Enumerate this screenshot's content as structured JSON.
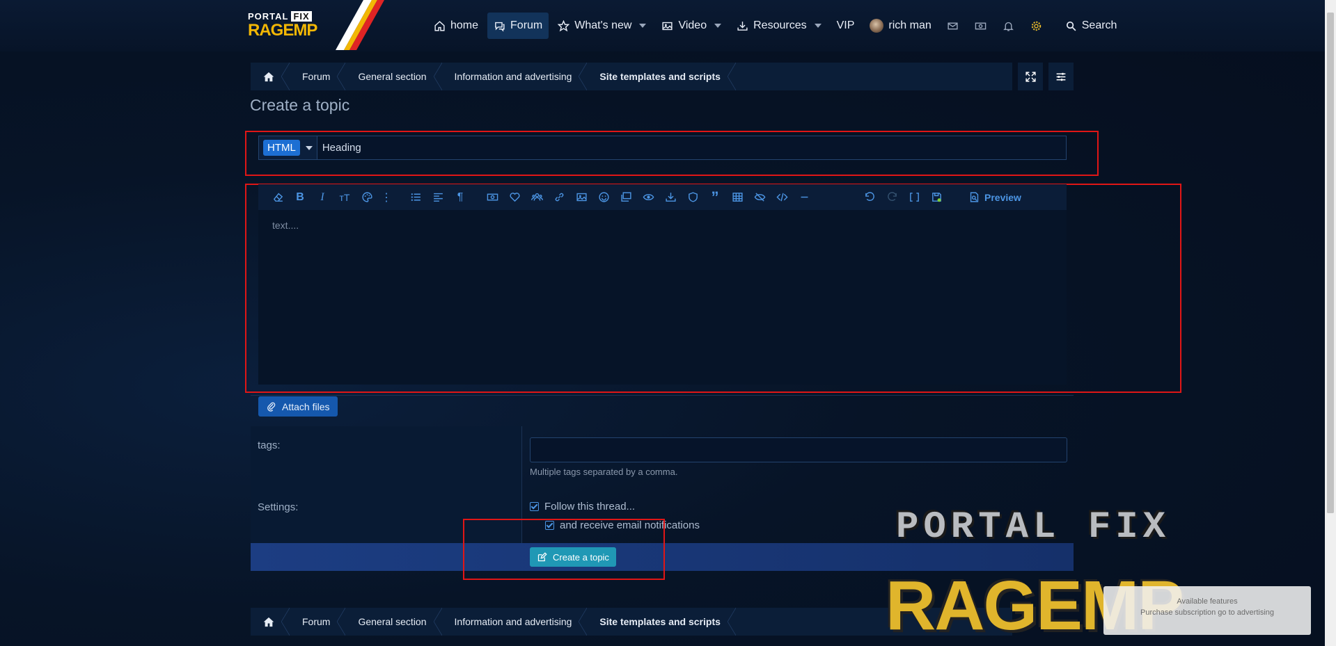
{
  "header": {
    "logo_top": "PORTAL",
    "logo_top_box": "FIX",
    "logo_bottom": "RAGEMP",
    "nav": [
      {
        "label": "home",
        "icon": "home-icon"
      },
      {
        "label": "Forum",
        "icon": "chat-icon"
      },
      {
        "label": "What's new",
        "icon": "star-icon"
      },
      {
        "label": "Video",
        "icon": "image-icon"
      },
      {
        "label": "Resources",
        "icon": "download-icon"
      },
      {
        "label": "VIP"
      }
    ],
    "user_name": "rich man",
    "search_label": "Search"
  },
  "breadcrumbs": [
    "Forum",
    "General section",
    "Information and advertising",
    "Site templates and scripts"
  ],
  "page_title": "Create a topic",
  "form": {
    "prefix": "HTML",
    "title_value": "Heading",
    "editor_placeholder": "text....",
    "preview_label": "Preview",
    "attach_label": "Attach files",
    "tags_label": "tags:",
    "tags_hint": "Multiple tags separated by a comma.",
    "settings_label": "Settings:",
    "follow_label": "Follow this thread...",
    "email_label": "and receive email notifications",
    "submit_label": "Create a topic"
  },
  "watermark": {
    "top": "PORTAL FIX",
    "bottom": "RAGEMP"
  },
  "notice": {
    "line1": "Available features",
    "line2": "Purchase subscription go to advertising"
  },
  "colors": {
    "accent": "#4c95e4",
    "highlight": "#e01616",
    "submit": "#2098b5"
  }
}
